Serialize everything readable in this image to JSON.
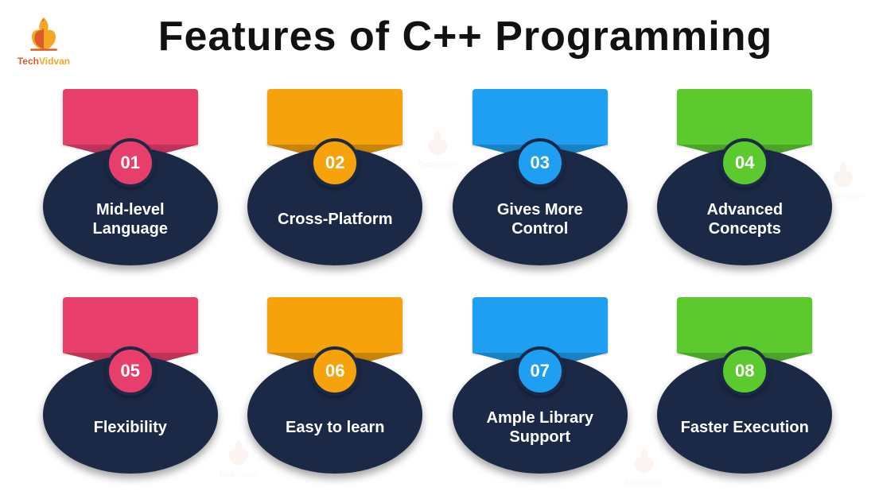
{
  "brand": {
    "name_part1": "Tech",
    "name_part2": "Vidvan",
    "color_primary": "#d95c2a",
    "color_secondary": "#f5a623"
  },
  "title": "Features of C++ Programming",
  "palette": {
    "pink": "#e83e6b",
    "orange": "#f5a20b",
    "blue": "#1e9ff2",
    "green": "#5cc92f",
    "navy": "#1b2947"
  },
  "features": [
    {
      "num": "01",
      "label": "Mid-level Language",
      "color": "#e83e6b"
    },
    {
      "num": "02",
      "label": "Cross-Platform",
      "color": "#f5a20b"
    },
    {
      "num": "03",
      "label": "Gives More Control",
      "color": "#1e9ff2"
    },
    {
      "num": "04",
      "label": "Advanced Concepts",
      "color": "#5cc92f"
    },
    {
      "num": "05",
      "label": "Flexibility",
      "color": "#e83e6b"
    },
    {
      "num": "06",
      "label": "Easy to learn",
      "color": "#f5a20b"
    },
    {
      "num": "07",
      "label": "Ample Library Support",
      "color": "#1e9ff2"
    },
    {
      "num": "08",
      "label": "Faster Execution",
      "color": "#5cc92f"
    }
  ]
}
